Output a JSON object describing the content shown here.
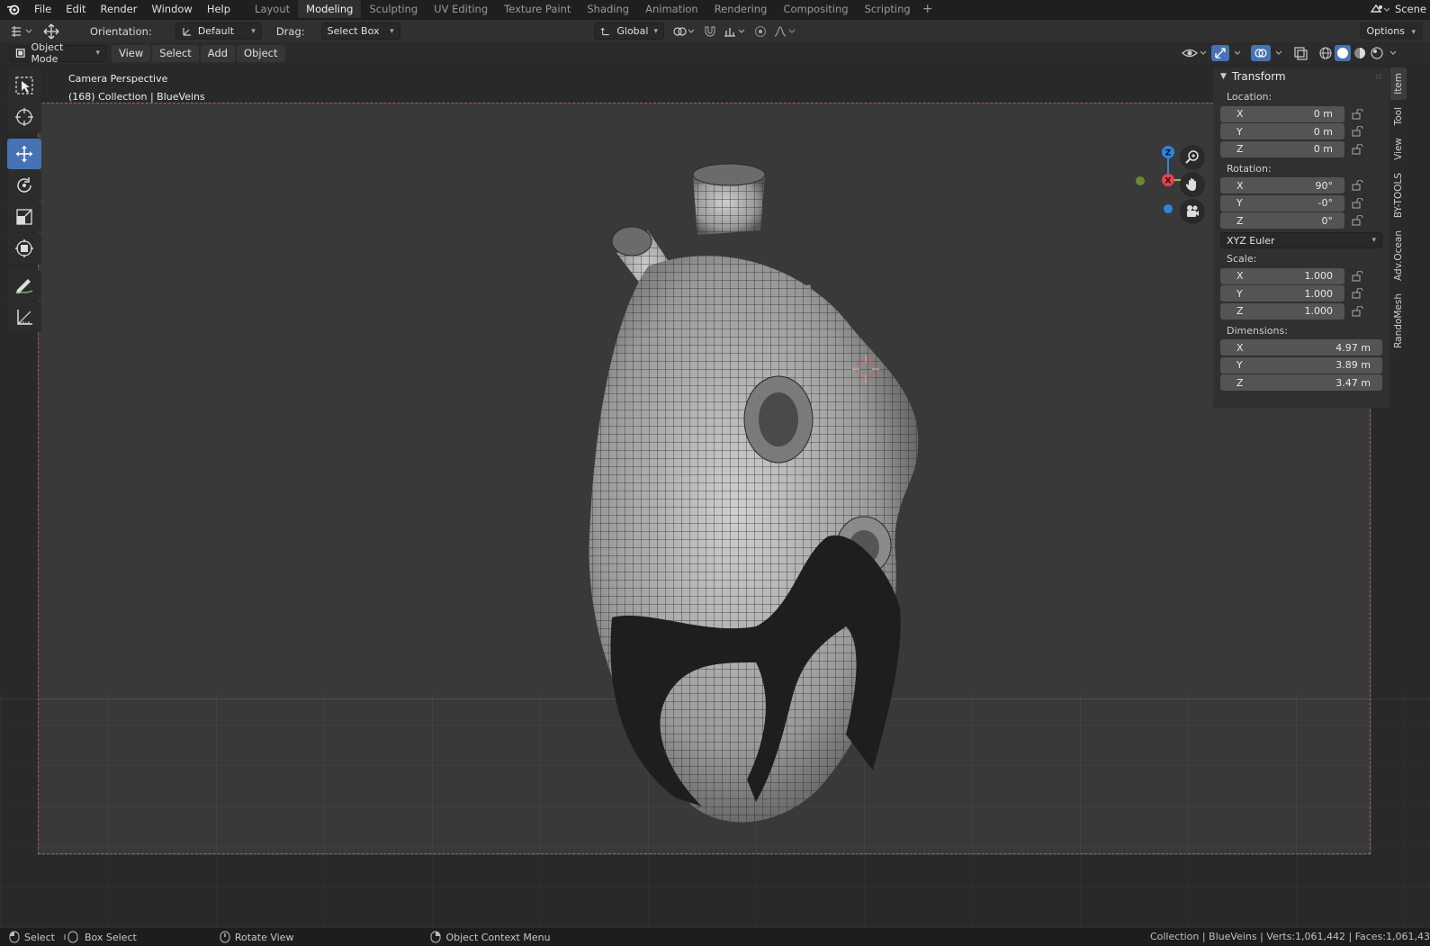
{
  "menu": {
    "items": [
      "File",
      "Edit",
      "Render",
      "Window",
      "Help"
    ]
  },
  "workspaces": {
    "tabs": [
      "Layout",
      "Modeling",
      "Sculpting",
      "UV Editing",
      "Texture Paint",
      "Shading",
      "Animation",
      "Rendering",
      "Compositing",
      "Scripting"
    ],
    "active": "Modeling",
    "scene_label": "Scene"
  },
  "toolheader": {
    "orientation_label": "Orientation:",
    "orientation_value": "Default",
    "drag_label": "Drag:",
    "drag_value": "Select Box",
    "transform_orientation": "Global",
    "options_label": "Options"
  },
  "viewport_header": {
    "mode": "Object Mode",
    "menus": [
      "View",
      "Select",
      "Add",
      "Object"
    ]
  },
  "viewport": {
    "perspective": "Camera Perspective",
    "collection_info": "(168) Collection | BlueVeins"
  },
  "gizmo": {
    "x": "X",
    "y": "Y",
    "z": "Z"
  },
  "transform": {
    "title": "Transform",
    "location_label": "Location:",
    "location": [
      {
        "axis": "X",
        "value": "0 m"
      },
      {
        "axis": "Y",
        "value": "0 m"
      },
      {
        "axis": "Z",
        "value": "0 m"
      }
    ],
    "rotation_label": "Rotation:",
    "rotation": [
      {
        "axis": "X",
        "value": "90°"
      },
      {
        "axis": "Y",
        "value": "-0°"
      },
      {
        "axis": "Z",
        "value": "0°"
      }
    ],
    "rotation_mode": "XYZ Euler",
    "scale_label": "Scale:",
    "scale": [
      {
        "axis": "X",
        "value": "1.000"
      },
      {
        "axis": "Y",
        "value": "1.000"
      },
      {
        "axis": "Z",
        "value": "1.000"
      }
    ],
    "dimensions_label": "Dimensions:",
    "dimensions": [
      {
        "axis": "X",
        "value": "4.97 m"
      },
      {
        "axis": "Y",
        "value": "3.89 m"
      },
      {
        "axis": "Z",
        "value": "3.47 m"
      }
    ]
  },
  "side_tabs": [
    "Item",
    "Tool",
    "View",
    "BY-TOOLS",
    "Adv.Ocean",
    "RandoMesh"
  ],
  "statusbar": {
    "select": "Select",
    "box_select": "Box Select",
    "rotate_view": "Rotate View",
    "context_menu": "Object Context Menu",
    "stats": "Collection | BlueVeins | Verts:1,061,442 | Faces:1,061,43"
  },
  "colors": {
    "accent": "#4772b3",
    "axis_x": "#e8404f",
    "axis_y": "#8bc53f",
    "axis_z": "#2f83e3",
    "camera_frame": "#b05a4a"
  }
}
